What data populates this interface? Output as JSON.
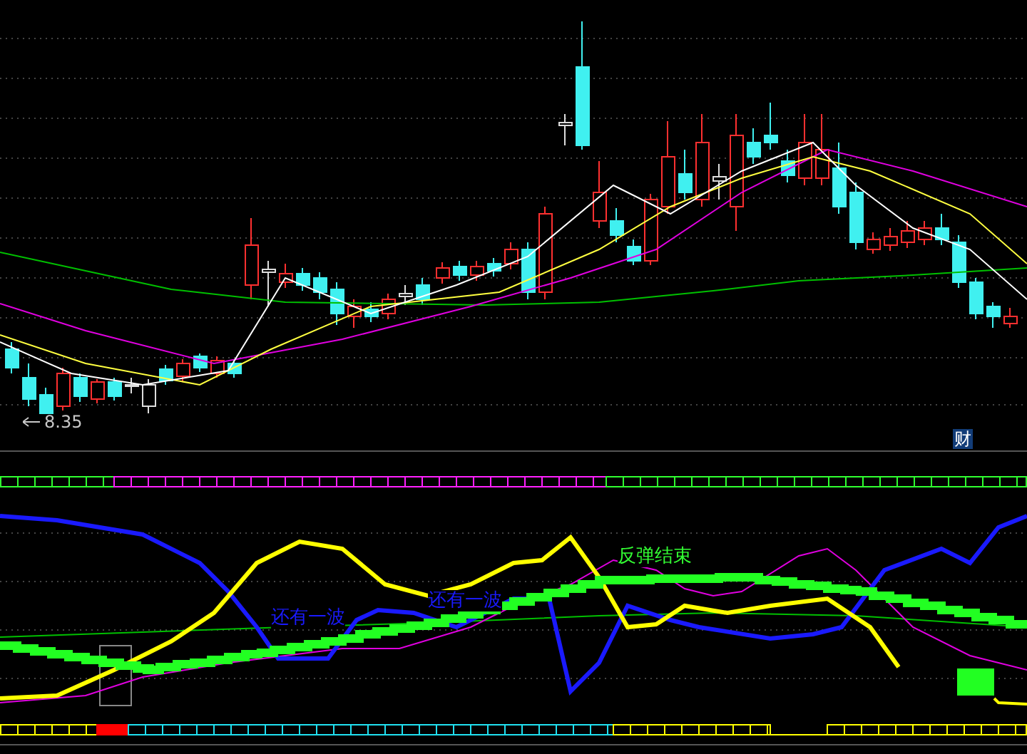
{
  "price_panel": {
    "low_marker": {
      "label": "8.35"
    },
    "badge": {
      "text": "财"
    }
  },
  "indicator_panel": {
    "annotations": [
      {
        "text": "还有一波",
        "color": "#1a1aff"
      },
      {
        "text": "还有一波",
        "color": "#1a1aff"
      },
      {
        "text": "反弹结束",
        "color": "#33ff33"
      }
    ]
  }
}
